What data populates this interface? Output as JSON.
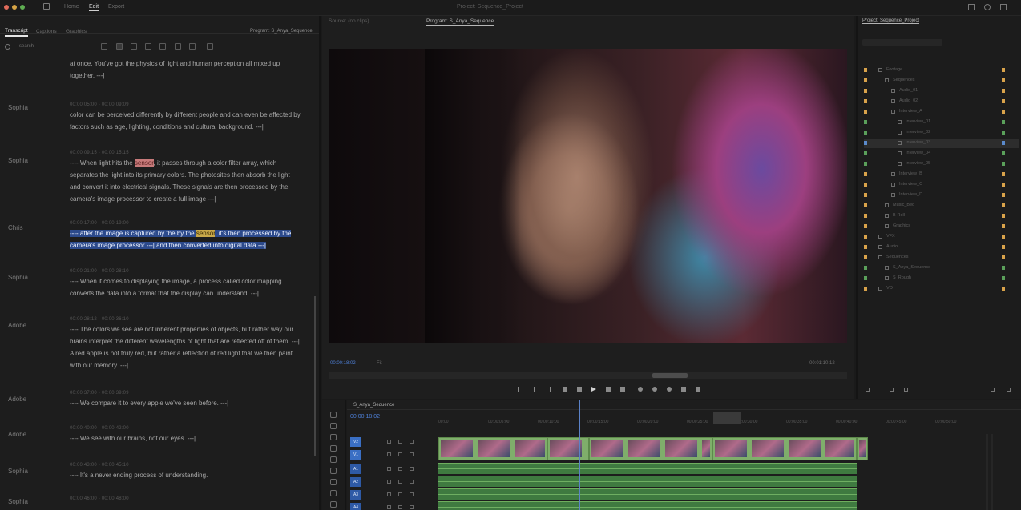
{
  "app": {
    "workspace_tabs": [
      "Home",
      "Edit",
      "Export"
    ],
    "active_workspace": "Edit"
  },
  "transcript_panel": {
    "tabs": [
      "Transcript",
      "Captions",
      "Graphics"
    ],
    "active_tab": "Transcript",
    "search_value": "search",
    "entries": [
      {
        "speaker": "",
        "timecode": "",
        "text": "at once. You've got the physics of light and human perception all mixed up together. ---|"
      },
      {
        "speaker": "Sophia",
        "timecode": "00:00:05:00 - 00:00:09:09",
        "text": "color can be perceived differently by different people and can even be affected by factors such as age, lighting, conditions and cultural background. ---|"
      },
      {
        "speaker": "Sophia",
        "timecode": "00:00:09:15 - 00:00:15:15",
        "text_before": "---- When light hits the ",
        "mark_red": "sensor",
        "text_after": ", it passes through a color filter array, which separates the light into its primary colors. The photosites then absorb the light and convert it into electrical signals. These signals are then processed by the camera's image processor to create a full image ---|"
      },
      {
        "speaker": "Chris",
        "timecode": "00:00:17:00 - 00:00:19:00",
        "text_before": "---- after the image is captured by the by the ",
        "mark_yellow": "sensor",
        "text_after": ", it's then processed by the camera's image processor ---| and then converted into digital data ---|"
      },
      {
        "speaker": "Sophia",
        "timecode": "00:00:21:00 - 00:00:28:10",
        "text": "---- When it comes to displaying the image, a process called color mapping converts the data into a format that the display can understand. ---|"
      },
      {
        "speaker": "Adobe",
        "timecode": "00:00:28:12 - 00:00:36:10",
        "text": "---- The colors we see are not inherent properties of objects, but rather way our brains interpret the different wavelengths of light that are reflected off of them. ---| A red apple is not truly red, but rather a reflection of red light that we then paint with our memory. ---|"
      },
      {
        "speaker": "Adobe",
        "timecode": "00:00:37:00 - 00:00:39:09",
        "text": "---- We compare it to every apple we've seen before. ---|"
      },
      {
        "speaker": "Adobe",
        "timecode": "00:00:40:00 - 00:00:42:00",
        "text": "---- We see with our brains, not our eyes. ---|"
      },
      {
        "speaker": "Sophia",
        "timecode": "00:00:43:00 - 00:00:45:10",
        "text": "---- It's a never ending process of understanding."
      },
      {
        "speaker": "Sophia",
        "timecode": "00:00:46:00 - 00:00:48:00",
        "text": ""
      }
    ]
  },
  "monitor": {
    "tabs": [
      "Source: (no clips)",
      "Program: S_Anya_Sequence"
    ],
    "active_tab": "Program: S_Anya_Sequence",
    "timecode": "00:00:18:02",
    "zoom": "Fit",
    "duration": "00:01:10:12"
  },
  "project_panel": {
    "title": "Project: Sequence_Project",
    "items": [
      {
        "name": "Footage",
        "color": "#d8a24a",
        "indent": 0
      },
      {
        "name": "Sequences",
        "color": "#d8a24a",
        "indent": 1
      },
      {
        "name": "Audio_01",
        "color": "#d8a24a",
        "indent": 2
      },
      {
        "name": "Audio_02",
        "color": "#d8a24a",
        "indent": 2
      },
      {
        "name": "Interview_A",
        "color": "#d8a24a",
        "indent": 2
      },
      {
        "name": "Interview_01",
        "color": "#5aa05a",
        "indent": 3
      },
      {
        "name": "Interview_02",
        "color": "#5aa05a",
        "indent": 3
      },
      {
        "name": "Interview_03",
        "color": "#5a8acb",
        "indent": 3
      },
      {
        "name": "Interview_04",
        "color": "#5aa05a",
        "indent": 3
      },
      {
        "name": "Interview_05",
        "color": "#5aa05a",
        "indent": 3
      },
      {
        "name": "Interview_B",
        "color": "#d8a24a",
        "indent": 2
      },
      {
        "name": "Interview_C",
        "color": "#d8a24a",
        "indent": 2
      },
      {
        "name": "Interview_D",
        "color": "#d8a24a",
        "indent": 2
      },
      {
        "name": "Music_Bed",
        "color": "#d8a24a",
        "indent": 1
      },
      {
        "name": "B-Roll",
        "color": "#d8a24a",
        "indent": 1
      },
      {
        "name": "Graphics",
        "color": "#d8a24a",
        "indent": 1
      },
      {
        "name": "VFX",
        "color": "#d8a24a",
        "indent": 0
      },
      {
        "name": "Audio",
        "color": "#d8a24a",
        "indent": 0
      },
      {
        "name": "Sequences",
        "color": "#d8a24a",
        "indent": 0
      },
      {
        "name": "S_Anya_Sequence",
        "color": "#5aa05a",
        "indent": 1
      },
      {
        "name": "S_Rough",
        "color": "#5aa05a",
        "indent": 1
      },
      {
        "name": "VO",
        "color": "#d8a24a",
        "indent": 0
      }
    ]
  },
  "timeline": {
    "sequence_tab": "S_Anya_Sequence",
    "timecode": "00:00:18:02",
    "ruler_ticks": [
      "00:00",
      "00:00:05:00",
      "00:00:10:00",
      "00:00:15:00",
      "00:00:20:00",
      "00:00:25:00",
      "00:00:30:00",
      "00:00:35:00",
      "00:00:40:00",
      "00:00:45:00",
      "00:00:50:00"
    ],
    "track_labels": [
      "V2",
      "V1",
      "A1",
      "A2",
      "A3",
      "A4"
    ]
  }
}
